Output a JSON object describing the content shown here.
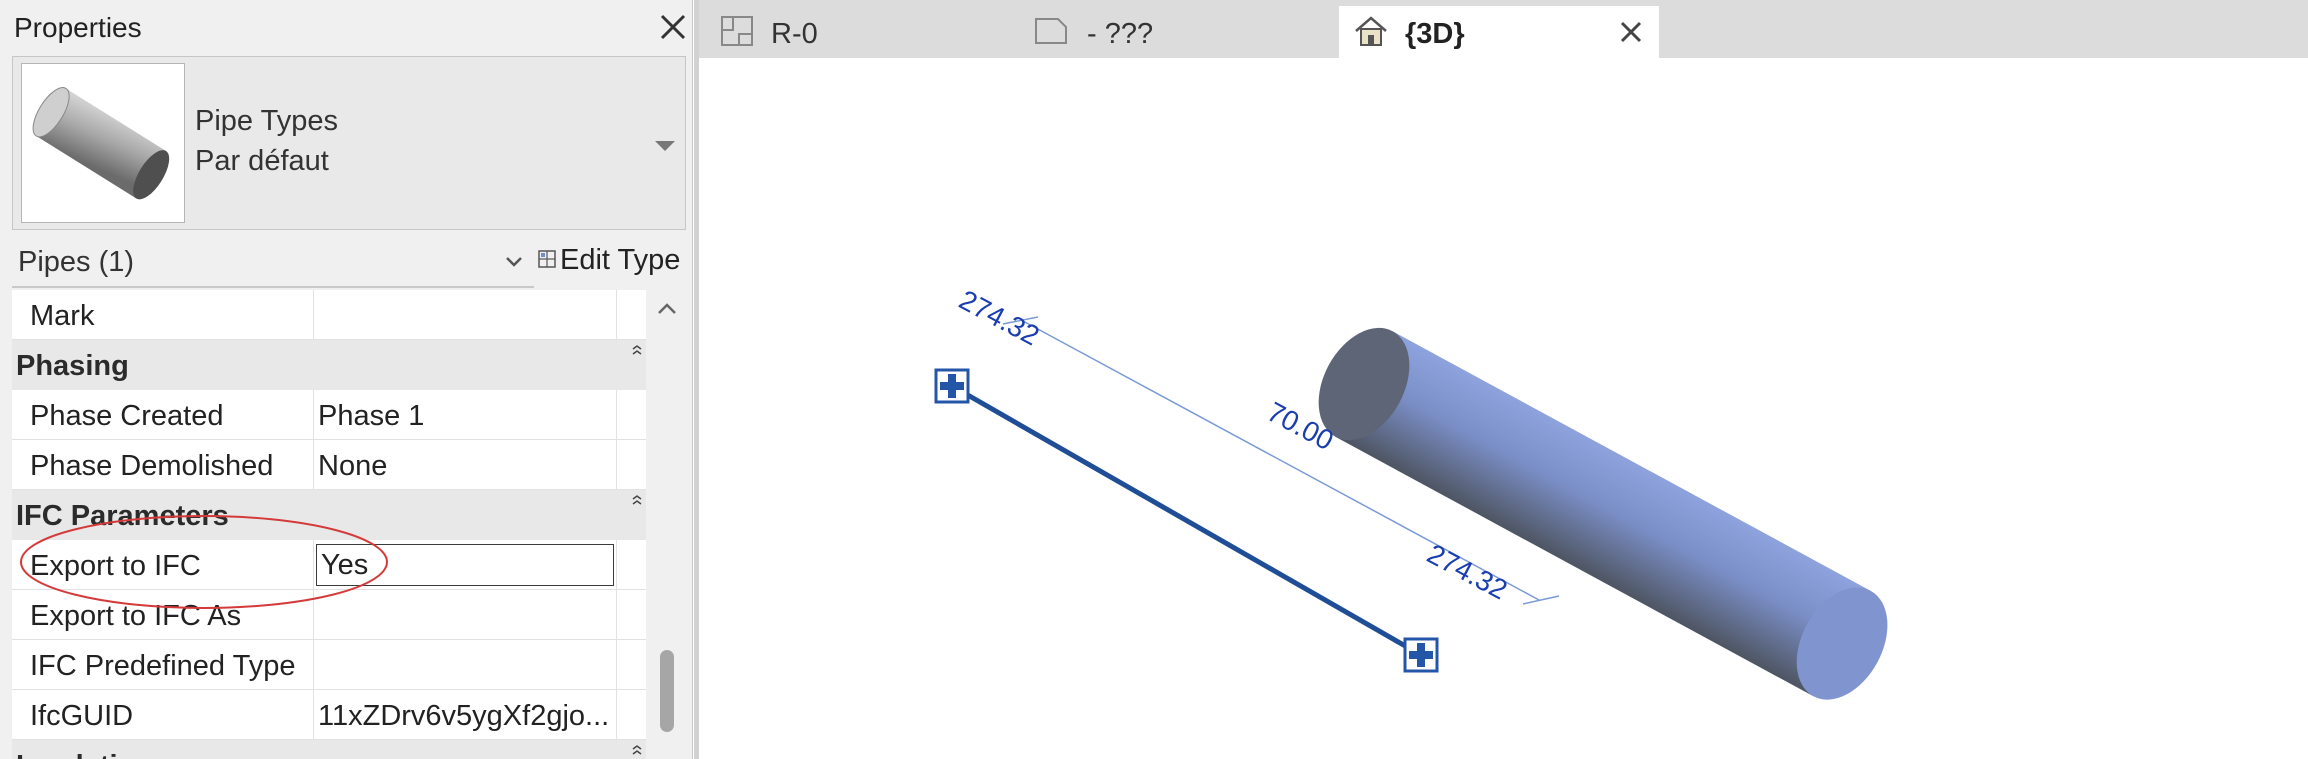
{
  "properties": {
    "title": "Properties",
    "type_selector": {
      "family": "Pipe Types",
      "type_name": "Par défaut"
    },
    "instance_filter": "Pipes (1)",
    "edit_type_label": "Edit Type",
    "rows": {
      "mark": {
        "name": "Mark",
        "value": ""
      },
      "phasing_group": "Phasing",
      "phase_created": {
        "name": "Phase Created",
        "value": "Phase 1"
      },
      "phase_demolished": {
        "name": "Phase Demolished",
        "value": "None"
      },
      "ifc_group": "IFC Parameters",
      "export_to_ifc": {
        "name": "Export to IFC",
        "value": "Yes"
      },
      "export_to_ifc_as": {
        "name": "Export to IFC As",
        "value": ""
      },
      "ifc_predefined_type": {
        "name": "IFC Predefined Type",
        "value": ""
      },
      "ifc_guid": {
        "name": "IfcGUID",
        "value": "11xZDrv6v5ygXf2gjo..."
      },
      "next_group": "Insulation"
    }
  },
  "tabs": [
    {
      "label": "R-0",
      "icon": "floor-plan-icon"
    },
    {
      "label": "- ???",
      "icon": "sheet-icon"
    },
    {
      "label": "{3D}",
      "icon": "3d-house-icon",
      "active": true
    }
  ],
  "view": {
    "dimension_end_1": "274.32",
    "dimension_length": "70.00",
    "dimension_end_2": "274.32"
  },
  "colors": {
    "pipe_fill": "#7f93c9",
    "pipe_center_line": "#1f4e96",
    "dimension_text": "#1a3db0",
    "annotation_ellipse": "#d43a3a"
  }
}
